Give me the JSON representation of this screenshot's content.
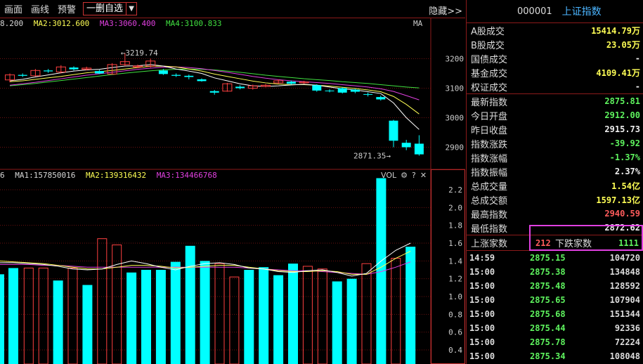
{
  "toolbar": {
    "items": [
      "画面",
      "画线",
      "预警"
    ],
    "select_label": "一删自选",
    "hide_label": "隐藏>>"
  },
  "kline": {
    "ma_labels": [
      {
        "text": "8.200",
        "color": "#d8d8d8"
      },
      {
        "text": "MA2:3012.600",
        "color": "#ffff55"
      },
      {
        "text": "MA3:3060.400",
        "color": "#e040e0"
      },
      {
        "text": "MA4:3100.833",
        "color": "#40e040"
      }
    ],
    "ma_tag": "MA",
    "high_label": "←3219.74",
    "low_label": "2871.35→",
    "y_axis": [
      "3200",
      "3100",
      "3000",
      "2900"
    ],
    "colors": {
      "up": "#ff4040",
      "down": "#00ffff",
      "ma1": "#ffffff",
      "ma2": "#ffff55",
      "ma3": "#e040e0",
      "ma4": "#40e040"
    },
    "candles": [
      {
        "o": 3128,
        "c": 3145,
        "h": 3150,
        "l": 3120
      },
      {
        "o": 3145,
        "c": 3142,
        "h": 3150,
        "l": 3138
      },
      {
        "o": 3142,
        "c": 3160,
        "h": 3165,
        "l": 3140
      },
      {
        "o": 3160,
        "c": 3157,
        "h": 3165,
        "l": 3152
      },
      {
        "o": 3155,
        "c": 3172,
        "h": 3178,
        "l": 3150
      },
      {
        "o": 3170,
        "c": 3164,
        "h": 3174,
        "l": 3160
      },
      {
        "o": 3164,
        "c": 3168,
        "h": 3173,
        "l": 3160
      },
      {
        "o": 3158,
        "c": 3150,
        "h": 3162,
        "l": 3148
      },
      {
        "o": 3148,
        "c": 3180,
        "h": 3185,
        "l": 3146
      },
      {
        "o": 3180,
        "c": 3190,
        "h": 3219.74,
        "l": 3175
      },
      {
        "o": 3172,
        "c": 3175,
        "h": 3180,
        "l": 3168
      },
      {
        "o": 3175,
        "c": 3192,
        "h": 3200,
        "l": 3170
      },
      {
        "o": 3160,
        "c": 3148,
        "h": 3165,
        "l": 3145
      },
      {
        "o": 3145,
        "c": 3142,
        "h": 3150,
        "l": 3138
      },
      {
        "o": 3142,
        "c": 3138,
        "h": 3146,
        "l": 3130
      },
      {
        "o": 3130,
        "c": 3124,
        "h": 3133,
        "l": 3122
      },
      {
        "o": 3090,
        "c": 3085,
        "h": 3094,
        "l": 3078
      },
      {
        "o": 3090,
        "c": 3115,
        "h": 3118,
        "l": 3088
      },
      {
        "o": 3105,
        "c": 3100,
        "h": 3110,
        "l": 3096
      },
      {
        "o": 3100,
        "c": 3108,
        "h": 3112,
        "l": 3095
      },
      {
        "o": 3106,
        "c": 3110,
        "h": 3114,
        "l": 3103
      },
      {
        "o": 3118,
        "c": 3125,
        "h": 3130,
        "l": 3115
      },
      {
        "o": 3122,
        "c": 3115,
        "h": 3126,
        "l": 3112
      },
      {
        "o": 3118,
        "c": 3121,
        "h": 3125,
        "l": 3115
      },
      {
        "o": 3110,
        "c": 3092,
        "h": 3113,
        "l": 3088
      },
      {
        "o": 3092,
        "c": 3090,
        "h": 3096,
        "l": 3086
      },
      {
        "o": 3100,
        "c": 3085,
        "h": 3103,
        "l": 3082
      },
      {
        "o": 3095,
        "c": 3088,
        "h": 3098,
        "l": 3083
      },
      {
        "o": 3080,
        "c": 3078,
        "h": 3085,
        "l": 3072
      },
      {
        "o": 3070,
        "c": 3062,
        "h": 3075,
        "l": 3058
      },
      {
        "o": 2990,
        "c": 2922,
        "h": 2993,
        "l": 2900
      },
      {
        "o": 2915,
        "c": 2900,
        "h": 2925,
        "l": 2890
      },
      {
        "o": 2912,
        "c": 2875.81,
        "h": 2940.59,
        "l": 2871.35
      }
    ],
    "ma1": [
      3125,
      3130,
      3138,
      3145,
      3152,
      3158,
      3162,
      3164,
      3170,
      3175,
      3176,
      3180,
      3175,
      3165,
      3158,
      3150,
      3135,
      3125,
      3115,
      3108,
      3106,
      3108,
      3111,
      3113,
      3110,
      3104,
      3098,
      3094,
      3088,
      3082,
      3050,
      3000,
      2960
    ],
    "ma2": [
      3122,
      3125,
      3130,
      3135,
      3140,
      3146,
      3152,
      3156,
      3160,
      3165,
      3170,
      3174,
      3175,
      3172,
      3165,
      3158,
      3148,
      3140,
      3132,
      3124,
      3118,
      3114,
      3112,
      3112,
      3110,
      3107,
      3103,
      3099,
      3094,
      3088,
      3072,
      3045,
      3012.6
    ],
    "ma3": [
      3110,
      3115,
      3120,
      3126,
      3132,
      3138,
      3144,
      3149,
      3154,
      3159,
      3164,
      3168,
      3171,
      3172,
      3170,
      3166,
      3160,
      3154,
      3147,
      3140,
      3134,
      3129,
      3125,
      3122,
      3119,
      3116,
      3112,
      3108,
      3104,
      3098,
      3089,
      3075,
      3060.4
    ],
    "ma4": [
      3108,
      3112,
      3116,
      3121,
      3126,
      3131,
      3136,
      3141,
      3146,
      3151,
      3155,
      3159,
      3162,
      3164,
      3165,
      3164,
      3162,
      3158,
      3154,
      3149,
      3144,
      3140,
      3136,
      3132,
      3129,
      3126,
      3122,
      3119,
      3116,
      3112,
      3108,
      3104,
      3100.8
    ]
  },
  "volume": {
    "labels": [
      {
        "text": "6",
        "color": "#d8d8d8"
      },
      {
        "text": "MA1:157850016",
        "color": "#d8d8d8"
      },
      {
        "text": "MA2:139316432",
        "color": "#ffff55"
      },
      {
        "text": "MA3:134466768",
        "color": "#e040e0"
      }
    ],
    "tag": "VOL",
    "y_axis": [
      "2.2",
      "2.0",
      "1.8",
      "1.6",
      "1.4",
      "1.2",
      "1.0",
      "0.8",
      "0.6",
      "0.4"
    ],
    "bars": [
      1.25,
      1.32,
      1.32,
      1.32,
      1.18,
      1.32,
      1.13,
      1.65,
      1.58,
      1.27,
      1.3,
      1.3,
      1.39,
      1.57,
      1.4,
      1.37,
      1.22,
      1.3,
      1.33,
      1.24,
      1.37,
      1.34,
      1.31,
      1.17,
      1.2,
      1.37,
      2.33,
      1.43,
      1.56
    ],
    "bar_up": [
      false,
      false,
      true,
      true,
      false,
      true,
      false,
      true,
      true,
      false,
      false,
      false,
      false,
      false,
      false,
      true,
      true,
      false,
      false,
      false,
      false,
      true,
      true,
      false,
      false,
      true,
      false,
      true,
      false
    ],
    "ma1": [
      1.38,
      1.38,
      1.37,
      1.36,
      1.34,
      1.31,
      1.3,
      1.31,
      1.36,
      1.4,
      1.37,
      1.33,
      1.3,
      1.34,
      1.37,
      1.38,
      1.36,
      1.32,
      1.31,
      1.28,
      1.27,
      1.29,
      1.3,
      1.27,
      1.23,
      1.26,
      1.4,
      1.52,
      1.6
    ],
    "ma2": [
      1.4,
      1.39,
      1.38,
      1.37,
      1.35,
      1.33,
      1.31,
      1.31,
      1.33,
      1.35,
      1.35,
      1.34,
      1.32,
      1.33,
      1.34,
      1.35,
      1.35,
      1.33,
      1.31,
      1.29,
      1.28,
      1.28,
      1.29,
      1.28,
      1.25,
      1.25,
      1.33,
      1.43,
      1.51
    ],
    "ma3": [
      1.36,
      1.36,
      1.36,
      1.35,
      1.35,
      1.34,
      1.33,
      1.33,
      1.33,
      1.33,
      1.33,
      1.33,
      1.33,
      1.33,
      1.33,
      1.33,
      1.33,
      1.32,
      1.31,
      1.3,
      1.29,
      1.29,
      1.28,
      1.27,
      1.26,
      1.25,
      1.28,
      1.33,
      1.39
    ]
  },
  "panel": {
    "code": "000001",
    "name": "上证指数",
    "rows1": [
      {
        "k": "A股成交",
        "v": "15414.79万",
        "c": "yl"
      },
      {
        "k": "B股成交",
        "v": "23.05万",
        "c": "yl"
      },
      {
        "k": "国债成交",
        "v": "-",
        "c": "wh"
      },
      {
        "k": "基金成交",
        "v": "4109.41万",
        "c": "yl"
      },
      {
        "k": "权证成交",
        "v": "-",
        "c": "wh"
      }
    ],
    "rows2": [
      {
        "k": "最新指数",
        "v": "2875.81",
        "c": "dn"
      },
      {
        "k": "今日开盘",
        "v": "2912.00",
        "c": "dn"
      },
      {
        "k": "昨日收盘",
        "v": "2915.73",
        "c": "wh"
      },
      {
        "k": "指数涨跌",
        "v": "-39.92",
        "c": "dn"
      },
      {
        "k": "指数涨幅",
        "v": "-1.37%",
        "c": "dn"
      },
      {
        "k": "指数振幅",
        "v": "2.37%",
        "c": "wh"
      },
      {
        "k": "总成交量",
        "v": "1.54亿",
        "c": "yl"
      },
      {
        "k": "总成交额",
        "v": "1597.13亿",
        "c": "yl"
      },
      {
        "k": "最高指数",
        "v": "2940.59",
        "c": "up"
      },
      {
        "k": "最低指数",
        "v": "2872.62",
        "c": "wh"
      }
    ],
    "adv_label": "上涨家数",
    "adv_value": "212",
    "dec_label": "下跌家数",
    "dec_value": "1111",
    "ticks": [
      {
        "t": "14:59",
        "p": "2875.15",
        "q": "104720"
      },
      {
        "t": "15:00",
        "p": "2875.38",
        "q": "134848"
      },
      {
        "t": "15:00",
        "p": "2875.48",
        "q": "128592"
      },
      {
        "t": "15:00",
        "p": "2875.65",
        "q": "107904"
      },
      {
        "t": "15:00",
        "p": "2875.68",
        "q": "151344"
      },
      {
        "t": "15:00",
        "p": "2875.44",
        "q": "92336"
      },
      {
        "t": "15:00",
        "p": "2875.78",
        "q": "72224"
      },
      {
        "t": "15:00",
        "p": "2875.34",
        "q": "108048"
      }
    ]
  }
}
